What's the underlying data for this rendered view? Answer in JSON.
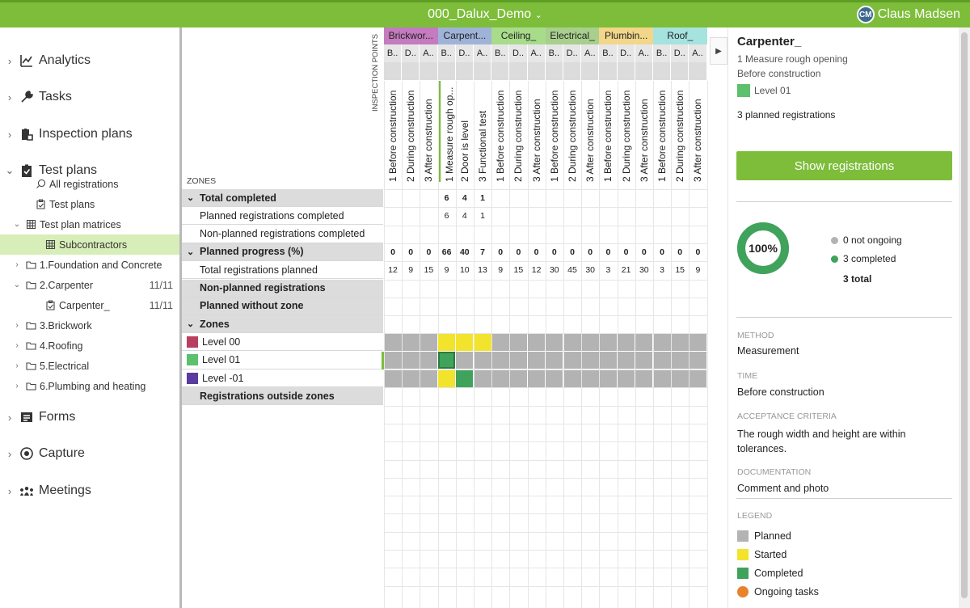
{
  "header": {
    "title": "000_Dalux_Demo",
    "avatar_initials": "CM",
    "user_name": "Claus Madsen"
  },
  "sidebar": {
    "main": [
      {
        "label": "Analytics",
        "icon": "chart-icon"
      },
      {
        "label": "Tasks",
        "icon": "wrench-icon"
      },
      {
        "label": "Inspection plans",
        "icon": "clipboard-lock-icon"
      },
      {
        "label": "Test plans",
        "icon": "clipboard-check-icon"
      }
    ],
    "test_plans_children": [
      {
        "label": "All registrations",
        "icon": "search-icon"
      },
      {
        "label": "Test plans",
        "icon": "clipboard-icon"
      },
      {
        "label": "Test plan matrices",
        "icon": "grid-icon"
      },
      {
        "label": "Subcontractors",
        "icon": "grid-icon"
      },
      {
        "label": "1.Foundation and Concrete",
        "icon": "folder-icon"
      },
      {
        "label": "2.Carpenter",
        "icon": "folder-icon",
        "count": "11/11"
      },
      {
        "label": "Carpenter_",
        "icon": "clipboard-icon",
        "count": "11/11"
      },
      {
        "label": "3.Brickwork",
        "icon": "folder-icon"
      },
      {
        "label": "4.Roofing",
        "icon": "folder-icon"
      },
      {
        "label": "5.Electrical",
        "icon": "folder-icon"
      },
      {
        "label": "6.Plumbing and heating",
        "icon": "folder-icon"
      }
    ],
    "bottom": [
      {
        "label": "Forms",
        "icon": "form-icon"
      },
      {
        "label": "Capture",
        "icon": "capture-icon"
      },
      {
        "label": "Meetings",
        "icon": "meetings-icon"
      }
    ]
  },
  "matrix": {
    "inspection_points_label": "INSPECTION POINTS",
    "zones_label": "ZONES",
    "groups": [
      {
        "label": "Brickwor...",
        "color": "#c47bbf"
      },
      {
        "label": "Carpent...",
        "color": "#9fb3d9"
      },
      {
        "label": "Ceiling_",
        "color": "#a8dc8a"
      },
      {
        "label": "Electrical_",
        "color": "#a8cf8e"
      },
      {
        "label": "Plumbin...",
        "color": "#f2d68a"
      },
      {
        "label": "Roof_",
        "color": "#a6e3df"
      }
    ],
    "col_abbrevs": [
      "B..",
      "D..",
      "A..",
      "B..",
      "D..",
      "A..",
      "B..",
      "D..",
      "A..",
      "B..",
      "D..",
      "A..",
      "B..",
      "D..",
      "A..",
      "B..",
      "D..",
      "A.."
    ],
    "columns": [
      "1 Before construction",
      "2 During construction",
      "3 After construction",
      "1 Measure rough op...",
      "2 Door is level",
      "3 Functional test",
      "1 Before construction",
      "2 During construction",
      "3 After construction",
      "1 Before construction",
      "2 During construction",
      "3 After construction",
      "1 Before construction",
      "2 During construction",
      "3 After construction",
      "1 Before construction",
      "2 During construction",
      "3 After construction"
    ],
    "rows": [
      {
        "label": "Total completed",
        "kind": "group",
        "chev": true,
        "values": [
          "",
          "",
          "",
          "6",
          "4",
          "1",
          "",
          "",
          "",
          "",
          "",
          "",
          "",
          "",
          "",
          "",
          "",
          ""
        ]
      },
      {
        "label": "Planned registrations completed",
        "kind": "sub",
        "values": [
          "",
          "",
          "",
          "6",
          "4",
          "1",
          "",
          "",
          "",
          "",
          "",
          "",
          "",
          "",
          "",
          "",
          "",
          ""
        ]
      },
      {
        "label": "Non-planned registrations completed",
        "kind": "sub",
        "values": [
          "",
          "",
          "",
          "",
          "",
          "",
          "",
          "",
          "",
          "",
          "",
          "",
          "",
          "",
          "",
          "",
          "",
          ""
        ]
      },
      {
        "label": "Planned progress (%)",
        "kind": "group",
        "chev": true,
        "values": [
          "0",
          "0",
          "0",
          "66",
          "40",
          "7",
          "0",
          "0",
          "0",
          "0",
          "0",
          "0",
          "0",
          "0",
          "0",
          "0",
          "0",
          "0"
        ]
      },
      {
        "label": "Total registrations planned",
        "kind": "sub",
        "values": [
          "12",
          "9",
          "15",
          "9",
          "10",
          "13",
          "9",
          "15",
          "12",
          "30",
          "45",
          "30",
          "3",
          "21",
          "30",
          "3",
          "15",
          "9"
        ]
      },
      {
        "label": "Non-planned registrations",
        "kind": "group",
        "values": []
      },
      {
        "label": "Planned without zone",
        "kind": "group",
        "values": []
      },
      {
        "label": "Zones",
        "kind": "group",
        "chev": true,
        "values": []
      },
      {
        "label": "Level 00",
        "kind": "zone",
        "color": "#b83f60",
        "cells": [
          "p",
          "p",
          "p",
          "s",
          "s",
          "s",
          "p",
          "p",
          "p",
          "p",
          "p",
          "p",
          "p",
          "p",
          "p",
          "p",
          "p",
          "p"
        ]
      },
      {
        "label": "Level 01",
        "kind": "zone",
        "color": "#5cc06e",
        "cells": [
          "p",
          "p",
          "p",
          "c",
          "p",
          "p",
          "p",
          "p",
          "p",
          "p",
          "p",
          "p",
          "p",
          "p",
          "p",
          "p",
          "p",
          "p"
        ]
      },
      {
        "label": "Level -01",
        "kind": "zone",
        "color": "#5a3c9e",
        "cells": [
          "p",
          "p",
          "p",
          "s",
          "c",
          "p",
          "p",
          "p",
          "p",
          "p",
          "p",
          "p",
          "p",
          "p",
          "p",
          "p",
          "p",
          "p"
        ]
      },
      {
        "label": "Registrations outside zones",
        "kind": "group",
        "values": []
      }
    ],
    "cell_colors": {
      "p": "#b3b3b3",
      "s": "#f2e42c",
      "c": "#3fa35c"
    }
  },
  "detail": {
    "title": "Carpenter_",
    "subtitle": "1 Measure rough opening",
    "phase": "Before construction",
    "level": "Level 01",
    "level_color": "#5cc06e",
    "planned_registrations": "3 planned registrations",
    "show_button": "Show registrations",
    "donut": {
      "percent": "100%",
      "completed_fraction": 1.0,
      "legend": [
        {
          "label": "0 not ongoing",
          "color": "#b3b3b3"
        },
        {
          "label": "3 completed",
          "color": "#3fa35c"
        }
      ],
      "total": "3 total"
    },
    "method_label": "METHOD",
    "method": "Measurement",
    "time_label": "TIME",
    "time": "Before construction",
    "criteria_label": "ACCEPTANCE CRITERIA",
    "criteria": "The rough width and height are within tolerances.",
    "documentation_label": "DOCUMENTATION",
    "documentation": "Comment and photo",
    "legend_label": "LEGEND",
    "legend": [
      {
        "label": "Planned",
        "color": "#b3b3b3"
      },
      {
        "label": "Started",
        "color": "#f2e42c"
      },
      {
        "label": "Completed",
        "color": "#3fa35c"
      },
      {
        "label": "Ongoing tasks",
        "color": "#e8822b"
      }
    ]
  }
}
